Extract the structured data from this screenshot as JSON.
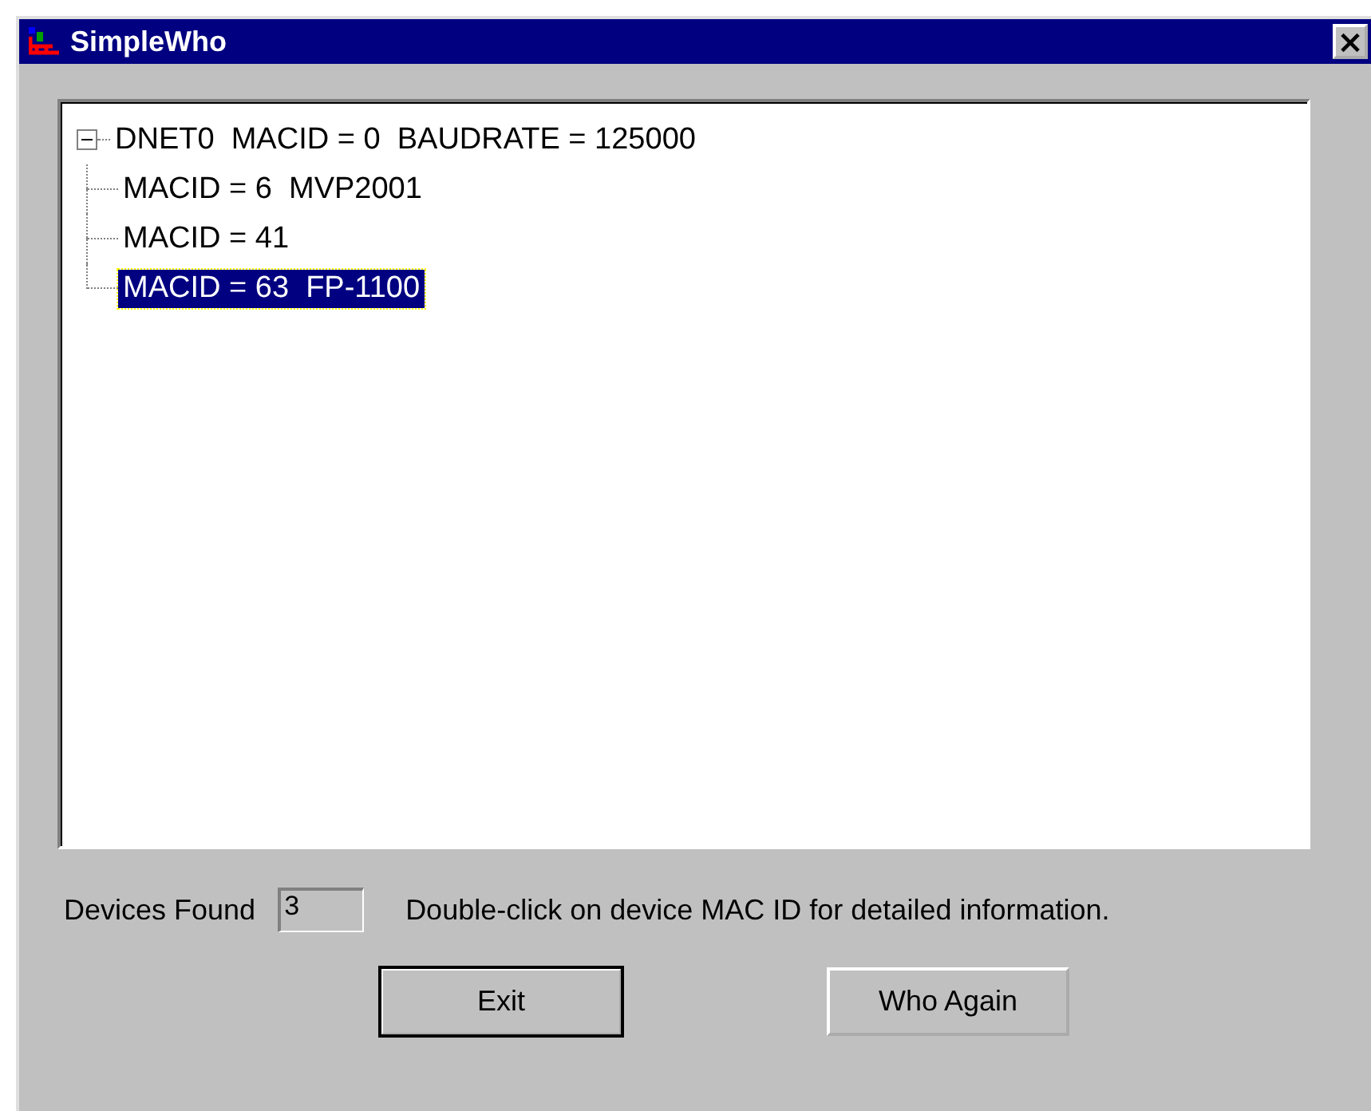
{
  "window": {
    "title": "SimpleWho",
    "close": "×"
  },
  "tree": {
    "items": [
      {
        "label": "DNET0  MACID = 0  BAUDRATE = 125000",
        "expanded": true,
        "selected": false,
        "children": [
          {
            "label": "MACID = 6  MVP2001",
            "selected": false
          },
          {
            "label": "MACID = 41",
            "selected": false
          },
          {
            "label": "MACID = 63  FP-1100",
            "selected": true
          }
        ]
      }
    ]
  },
  "devices_found": {
    "label": "Devices Found",
    "value": "3"
  },
  "hint": "Double-click on device MAC ID for detailed information.",
  "buttons": [
    {
      "label": "Exit",
      "default": true
    },
    {
      "label": "Who Again",
      "default": false
    }
  ]
}
